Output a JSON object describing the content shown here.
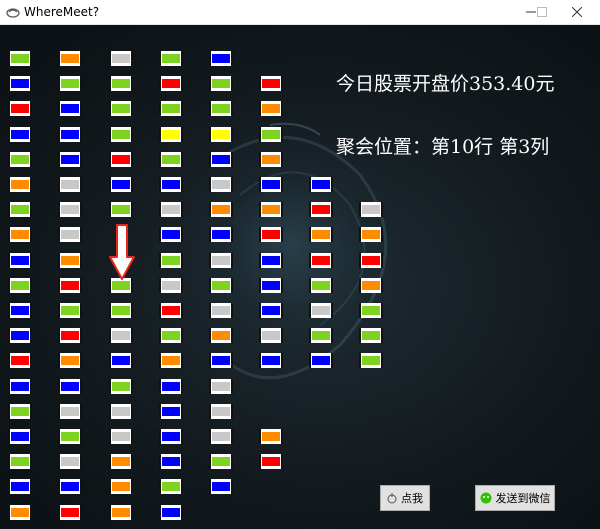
{
  "window": {
    "title": "WhereMeet?"
  },
  "info": {
    "headline": "今日股票开盘价353.40元",
    "location": "聚会位置：第10行  第3列"
  },
  "buttons": {
    "locate_label": "点我",
    "send_label": "发送到微信"
  },
  "colors": {
    "G": "#7ed321",
    "O": "#ff8c00",
    "W": "#c8c8c8",
    "B": "#0000ff",
    "R": "#ff0000",
    "Y": "#ffff00",
    "arrow": "#e8261a"
  },
  "highlight": {
    "row": 10,
    "col": 3
  },
  "grid": [
    [
      "G",
      "O",
      "W",
      "G",
      "B"
    ],
    [
      "B",
      "G",
      "G",
      "R",
      "G",
      "R"
    ],
    [
      "R",
      "B",
      "G",
      "G",
      "G",
      "O"
    ],
    [
      "B",
      "B",
      "G",
      "Y",
      "Y",
      "G"
    ],
    [
      "G",
      "B",
      "R",
      "G",
      "B",
      "O"
    ],
    [
      "O",
      "W",
      "B",
      "B",
      "W",
      "B",
      "B"
    ],
    [
      "G",
      "W",
      "G",
      "W",
      "O",
      "O",
      "R",
      "W"
    ],
    [
      "O",
      "W",
      "",
      "B",
      "B",
      "R",
      "O",
      "O"
    ],
    [
      "B",
      "O",
      "",
      "G",
      "W",
      "B",
      "R",
      "R"
    ],
    [
      "G",
      "R",
      "G",
      "W",
      "G",
      "B",
      "G",
      "O"
    ],
    [
      "B",
      "G",
      "G",
      "R",
      "W",
      "B",
      "W",
      "G"
    ],
    [
      "B",
      "R",
      "W",
      "G",
      "O",
      "W",
      "G",
      "G"
    ],
    [
      "R",
      "O",
      "B",
      "O",
      "B",
      "B",
      "B",
      "G"
    ],
    [
      "B",
      "B",
      "G",
      "B",
      "W"
    ],
    [
      "G",
      "W",
      "W",
      "B",
      "W"
    ],
    [
      "B",
      "G",
      "W",
      "B",
      "W",
      "O"
    ],
    [
      "G",
      "W",
      "O",
      "B",
      "G",
      "R"
    ],
    [
      "B",
      "B",
      "O",
      "G",
      "B"
    ],
    [
      "O",
      "R",
      "O",
      "B"
    ]
  ]
}
